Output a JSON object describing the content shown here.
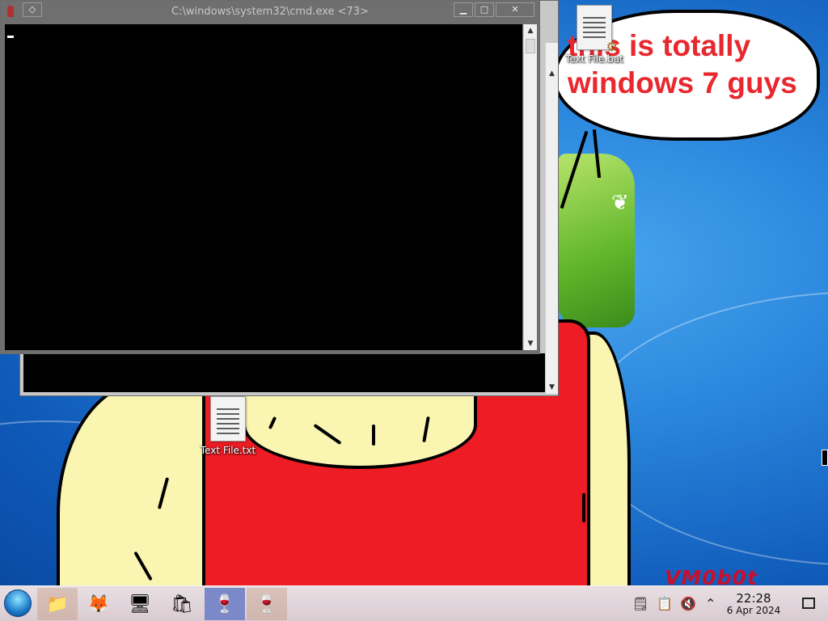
{
  "cmd_window": {
    "title": "C:\\windows\\system32\\cmd.exe <73>"
  },
  "desktop": {
    "icons": [
      {
        "label": "Text File.bat"
      },
      {
        "label": "Text File.txt"
      }
    ],
    "bubble_text": "this is totally windows 7 guys",
    "watermark": "VM0b0t"
  },
  "taskbar": {
    "apps": [
      {
        "name": "file-manager",
        "glyph": "📁"
      },
      {
        "name": "firefox",
        "glyph": "🦊"
      },
      {
        "name": "control-panel",
        "glyph": "🖥"
      },
      {
        "name": "paint-bucket",
        "glyph": "🛍"
      },
      {
        "name": "wine-running",
        "glyph": "🍷"
      },
      {
        "name": "wine",
        "glyph": "🍷"
      }
    ],
    "clock": {
      "time": "22:28",
      "date": "6 Apr 2024"
    }
  },
  "colors": {
    "desktop_blue": "#1b6fd0",
    "bubble_text": "#e8272e",
    "shirt": "#ee1c24",
    "skin": "#fbf5b2",
    "taskbar": "#e2d6db"
  }
}
